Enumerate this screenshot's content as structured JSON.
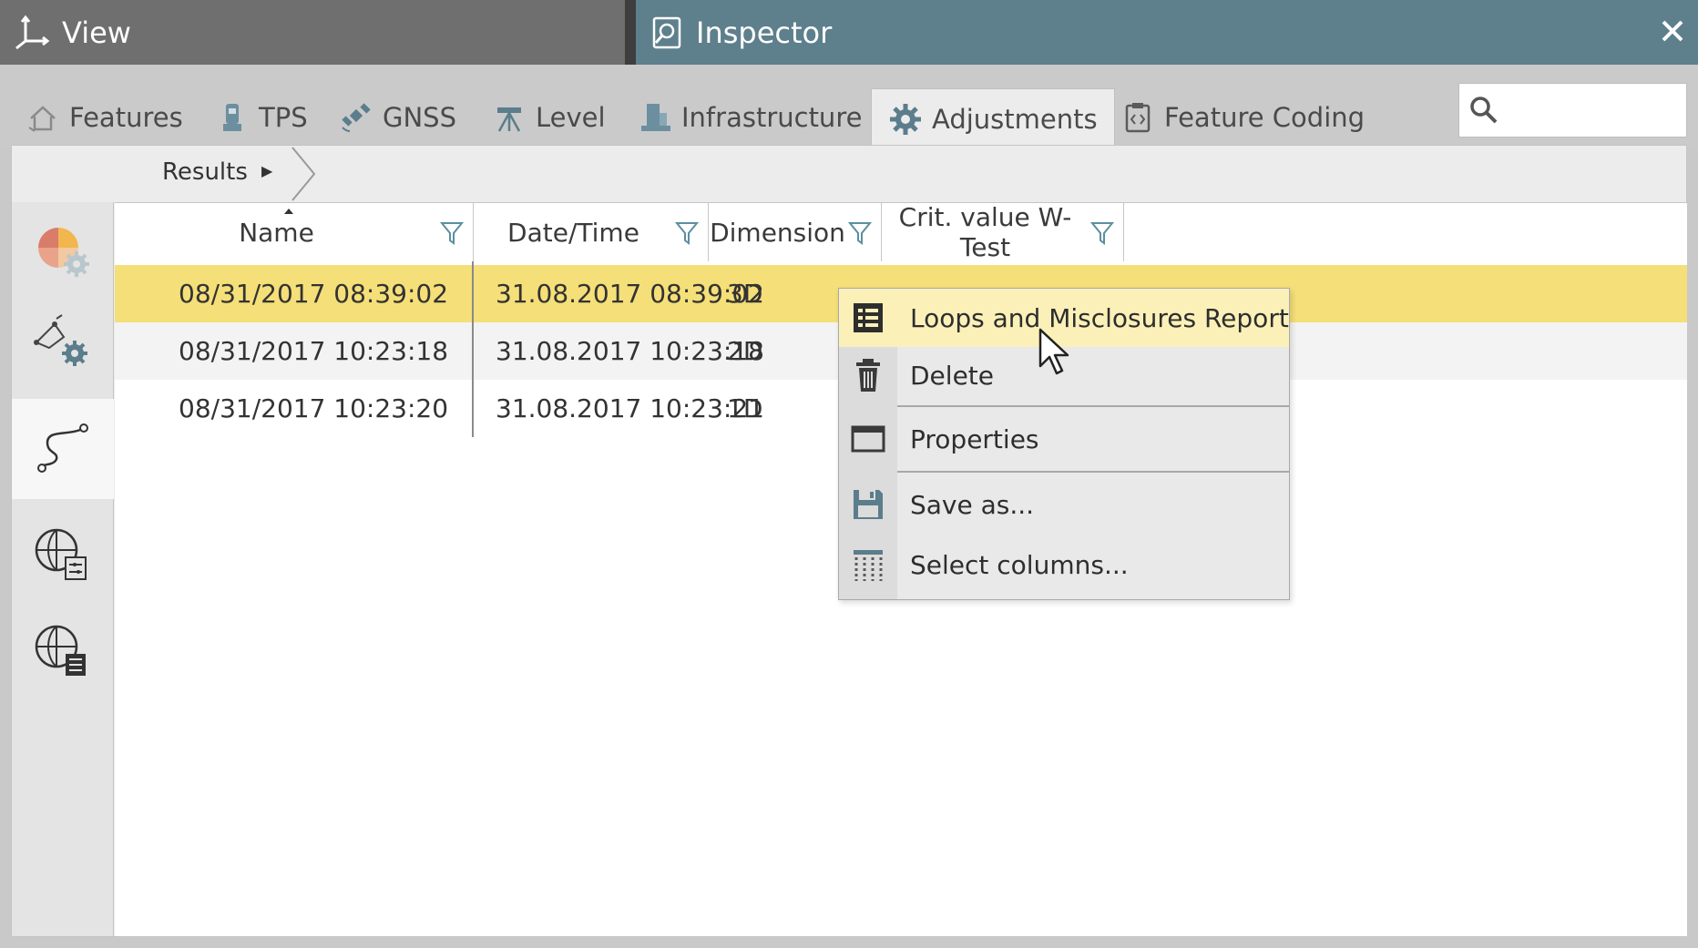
{
  "titlebar": {
    "view_label": "View",
    "inspector_label": "Inspector",
    "inspector_color": "#5e7f8c"
  },
  "tabs": [
    {
      "label": "Features",
      "icon": "house-icon"
    },
    {
      "label": "TPS",
      "icon": "tps-instrument-icon"
    },
    {
      "label": "GNSS",
      "icon": "satellite-icon"
    },
    {
      "label": "Level",
      "icon": "level-tripod-icon"
    },
    {
      "label": "Infrastructure",
      "icon": "buildings-icon"
    },
    {
      "label": "Adjustments",
      "icon": "gear-icon",
      "active": true
    },
    {
      "label": "Feature Coding",
      "icon": "clipboard-code-icon"
    }
  ],
  "search": {
    "placeholder": "",
    "value": ""
  },
  "breadcrumb": {
    "label": "Results"
  },
  "sidebar": {
    "items": [
      {
        "name": "adjustment-settings",
        "icon": "pie-gear-icon"
      },
      {
        "name": "network-settings",
        "icon": "network-gear-icon"
      },
      {
        "name": "loops",
        "icon": "loop-path-icon",
        "active": true
      },
      {
        "name": "geodetic-settings",
        "icon": "globe-settings-icon"
      },
      {
        "name": "geodetic-report",
        "icon": "globe-report-icon"
      }
    ]
  },
  "grid": {
    "columns": [
      "Name",
      "Date/Time",
      "Dimension",
      "Crit. value W-Test"
    ],
    "rows": [
      {
        "name": "08/31/2017 08:39:02",
        "datetime": "31.08.2017 08:39:02",
        "dimension": "3D",
        "selected": true
      },
      {
        "name": "08/31/2017 10:23:18",
        "datetime": "31.08.2017 10:23:18",
        "dimension": "2D"
      },
      {
        "name": "08/31/2017 10:23:20",
        "datetime": "31.08.2017 10:23:21",
        "dimension": "1D"
      }
    ]
  },
  "context_menu": {
    "items": [
      {
        "label": "Loops and Misclosures Report",
        "icon": "report-list-icon",
        "highlighted": true
      },
      {
        "label": "Delete",
        "icon": "trash-icon"
      },
      {
        "label": "Properties",
        "icon": "window-icon"
      },
      {
        "label": "Save as...",
        "icon": "floppy-disk-icon"
      },
      {
        "label": "Select columns...",
        "icon": "columns-icon"
      }
    ]
  },
  "colors": {
    "selected_row": "#f5df78",
    "menu_highlight": "#fbf1b8",
    "accent_teal": "#5e7f8c"
  }
}
